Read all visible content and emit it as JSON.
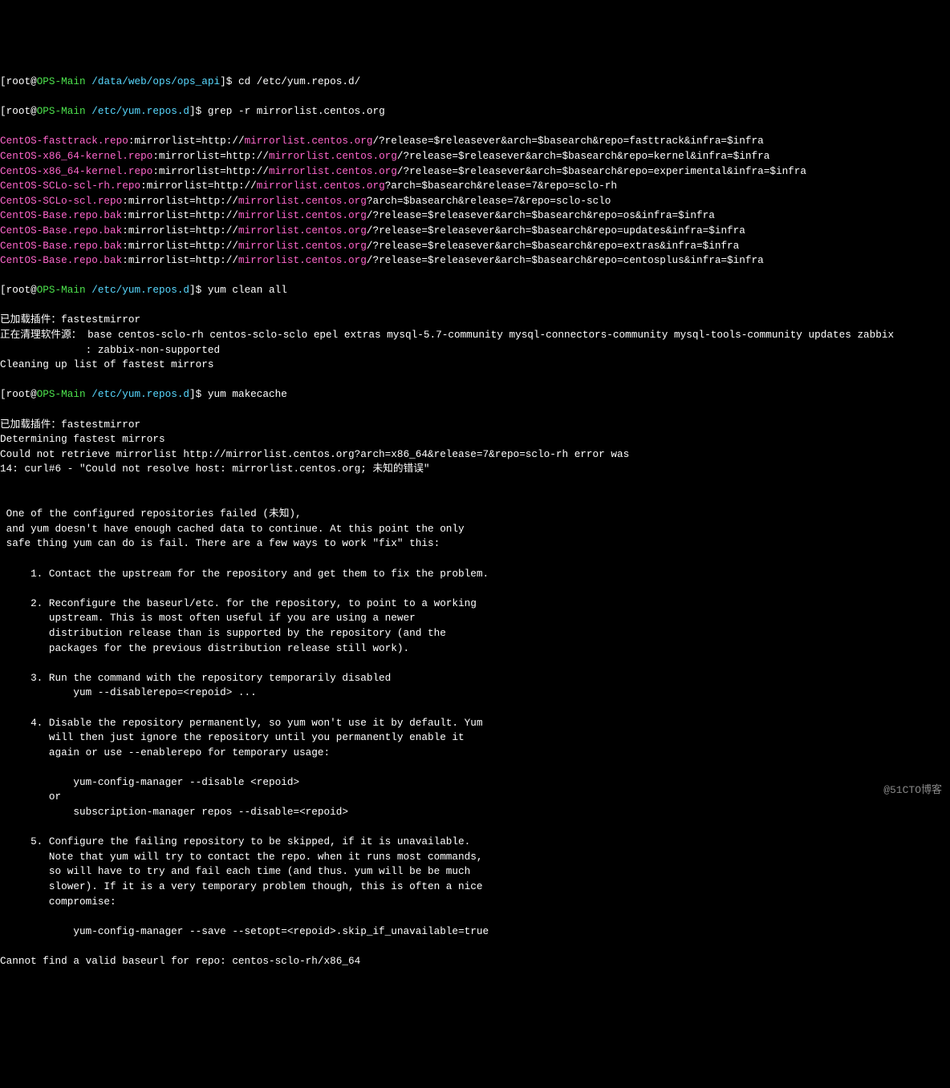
{
  "prompt1": {
    "bracket_open": "[root@",
    "host": "OPS-Main",
    "path": " /data/web/ops/ops_api",
    "close": "]$ ",
    "cmd": "cd /etc/yum.repos.d/"
  },
  "prompt2": {
    "bracket_open": "[root@",
    "host": "OPS-Main",
    "path": " /etc/yum.repos.d",
    "close": "]$ ",
    "cmd": "grep -r mirrorlist.centos.org"
  },
  "repos": [
    {
      "file": "CentOS-fasttrack.repo",
      "mid": ":mirrorlist=http://",
      "url": "mirrorlist.centos.org",
      "tail": "/?release=$releasever&arch=$basearch&repo=fasttrack&infra=$infra"
    },
    {
      "file": "CentOS-x86_64-kernel.repo",
      "mid": ":mirrorlist=http://",
      "url": "mirrorlist.centos.org",
      "tail": "/?release=$releasever&arch=$basearch&repo=kernel&infra=$infra"
    },
    {
      "file": "CentOS-x86_64-kernel.repo",
      "mid": ":mirrorlist=http://",
      "url": "mirrorlist.centos.org",
      "tail": "/?release=$releasever&arch=$basearch&repo=experimental&infra=$infra"
    },
    {
      "file": "CentOS-SCLo-scl-rh.repo",
      "mid": ":mirrorlist=http://",
      "url": "mirrorlist.centos.org",
      "tail": "?arch=$basearch&release=7&repo=sclo-rh"
    },
    {
      "file": "CentOS-SCLo-scl.repo",
      "mid": ":mirrorlist=http://",
      "url": "mirrorlist.centos.org",
      "tail": "?arch=$basearch&release=7&repo=sclo-sclo"
    },
    {
      "file": "CentOS-Base.repo.bak",
      "mid": ":mirrorlist=http://",
      "url": "mirrorlist.centos.org",
      "tail": "/?release=$releasever&arch=$basearch&repo=os&infra=$infra"
    },
    {
      "file": "CentOS-Base.repo.bak",
      "mid": ":mirrorlist=http://",
      "url": "mirrorlist.centos.org",
      "tail": "/?release=$releasever&arch=$basearch&repo=updates&infra=$infra"
    },
    {
      "file": "CentOS-Base.repo.bak",
      "mid": ":mirrorlist=http://",
      "url": "mirrorlist.centos.org",
      "tail": "/?release=$releasever&arch=$basearch&repo=extras&infra=$infra"
    },
    {
      "file": "CentOS-Base.repo.bak",
      "mid": ":mirrorlist=http://",
      "url": "mirrorlist.centos.org",
      "tail": "/?release=$releasever&arch=$basearch&repo=centosplus&infra=$infra"
    }
  ],
  "prompt3": {
    "bracket_open": "[root@",
    "host": "OPS-Main",
    "path": " /etc/yum.repos.d",
    "close": "]$ ",
    "cmd": "yum clean all"
  },
  "lines_after1": [
    "已加载插件：fastestmirror",
    "正在清理软件源： base centos-sclo-rh centos-sclo-sclo epel extras mysql-5.7-community mysql-connectors-community mysql-tools-community updates zabbix",
    "              : zabbix-non-supported",
    "Cleaning up list of fastest mirrors"
  ],
  "prompt4": {
    "bracket_open": "[root@",
    "host": "OPS-Main",
    "path": " /etc/yum.repos.d",
    "close": "]$ ",
    "cmd": "yum makecache"
  },
  "lines_after2": [
    "已加载插件：fastestmirror",
    "Determining fastest mirrors",
    "Could not retrieve mirrorlist http://mirrorlist.centos.org?arch=x86_64&release=7&repo=sclo-rh error was",
    "14: curl#6 - \"Could not resolve host: mirrorlist.centos.org; 未知的错误\"",
    "",
    "",
    " One of the configured repositories failed (未知),",
    " and yum doesn't have enough cached data to continue. At this point the only",
    " safe thing yum can do is fail. There are a few ways to work \"fix\" this:",
    "",
    "     1. Contact the upstream for the repository and get them to fix the problem.",
    "",
    "     2. Reconfigure the baseurl/etc. for the repository, to point to a working",
    "        upstream. This is most often useful if you are using a newer",
    "        distribution release than is supported by the repository (and the",
    "        packages for the previous distribution release still work).",
    "",
    "     3. Run the command with the repository temporarily disabled",
    "            yum --disablerepo=<repoid> ...",
    "",
    "     4. Disable the repository permanently, so yum won't use it by default. Yum",
    "        will then just ignore the repository until you permanently enable it",
    "        again or use --enablerepo for temporary usage:",
    "",
    "            yum-config-manager --disable <repoid>",
    "        or",
    "            subscription-manager repos --disable=<repoid>",
    "",
    "     5. Configure the failing repository to be skipped, if it is unavailable.",
    "        Note that yum will try to contact the repo. when it runs most commands,",
    "        so will have to try and fail each time (and thus. yum will be be much",
    "        slower). If it is a very temporary problem though, this is often a nice",
    "        compromise:",
    "",
    "            yum-config-manager --save --setopt=<repoid>.skip_if_unavailable=true",
    "",
    "Cannot find a valid baseurl for repo: centos-sclo-rh/x86_64"
  ],
  "watermark": "@51CTO博客"
}
